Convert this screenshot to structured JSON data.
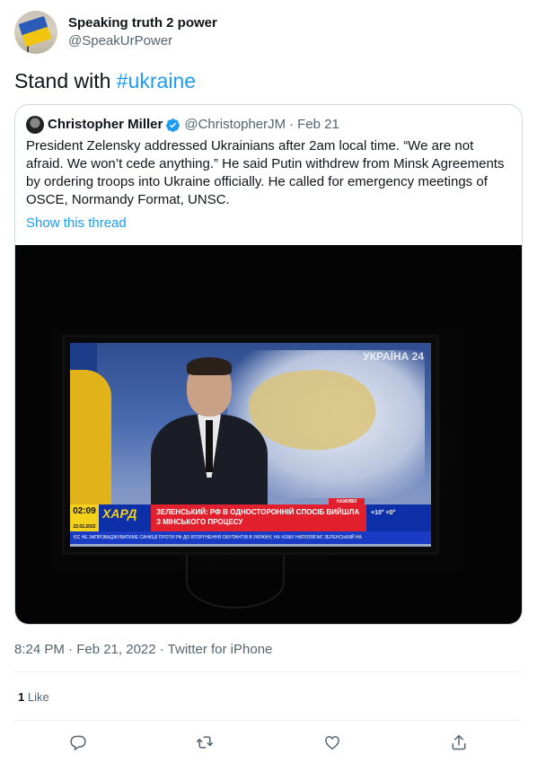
{
  "tweet": {
    "author_name": "Speaking truth 2 power",
    "author_handle": "@SpeakUrPower",
    "text_prefix": "Stand with ",
    "hashtag": "#ukraine",
    "timestamp": "8:24 PM · Feb 21, 2022 · Twitter for iPhone",
    "likes_count": "1",
    "likes_label": " Like"
  },
  "quote": {
    "author_name": "Christopher Miller",
    "author_handle": "@ChristopherJM",
    "separator": "·",
    "date": "Feb 21",
    "text": "President Zelensky addressed Ukrainians after 2am local time. “We are not afraid. We won’t cede anything.” He said Putin withdrew from Minsk Agreements by ordering troops into Ukraine officially. He called for emergency meetings of OSCE, Normandy Format, UNSC.",
    "show_thread": "Show this thread"
  },
  "tv": {
    "channel": "УКРАЇНА 24",
    "clock": "02:09",
    "clock_date": "22.02.2022",
    "brand": "ХАРД",
    "live": "НАЖИВО",
    "headline": "ЗЕЛЕНСЬКИЙ: РФ В ОДНОСТОРОННІЙ СПОСІБ ВИЙШЛА З МІНСЬКОГО ПРОЦЕСУ",
    "weather": "+10° <0°",
    "ticker": "ЄС НЕ ЗАПРОВАДЖУВАТИМЕ САНКЦІЇ ПРОТИ РФ ДО ВТОРГНЕННЯ ОКУПАНТІВ В УКРАЇНУ, НА ЧОМУ НАПОЛЯГАЄ ЗЕЛЕНСЬКИЙ НА"
  },
  "icons": {
    "reply": "reply-icon",
    "retweet": "retweet-icon",
    "like": "like-icon",
    "share": "share-icon",
    "verified": "verified-badge-icon"
  },
  "colors": {
    "link": "#1d9bf0",
    "secondary_text": "#536471",
    "border": "#cfd9de"
  }
}
